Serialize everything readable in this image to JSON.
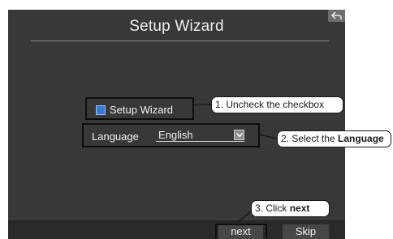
{
  "window": {
    "title": "Setup Wizard",
    "back_icon": "back-arrow-icon"
  },
  "setup": {
    "checkbox_label": "Setup Wizard",
    "checkbox_checked": true,
    "checkbox_color": "#3b7bd1"
  },
  "language": {
    "label": "Language",
    "selected": "English",
    "dropdown_icon": "chevron-down-icon"
  },
  "buttons": {
    "next": "next",
    "skip": "Skip"
  },
  "callouts": {
    "step1": "1. Uncheck the checkbox",
    "step2_prefix": "2. Select the ",
    "step2_bold": "Language",
    "step3_prefix": "3. Click ",
    "step3_bold": "next"
  },
  "colors": {
    "window_bg": "#383838",
    "bottom_bar_bg": "#2a2a2a",
    "text": "#f2f2f2"
  }
}
